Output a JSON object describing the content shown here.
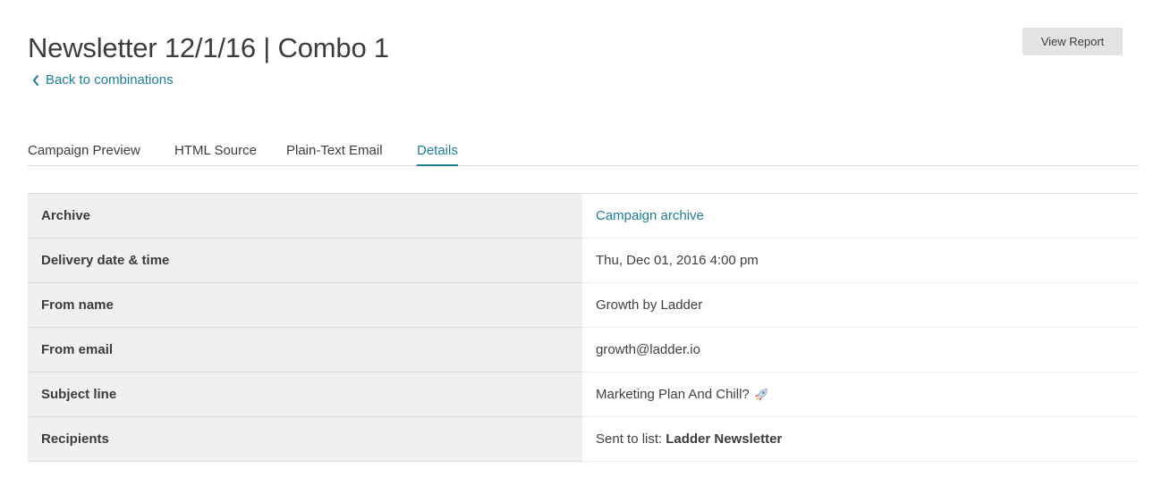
{
  "header": {
    "title": "Newsletter 12/1/16 | Combo 1",
    "back_label": "Back to combinations",
    "view_report_label": "View Report"
  },
  "tabs": [
    {
      "label": "Campaign Preview",
      "active": false
    },
    {
      "label": "HTML Source",
      "active": false
    },
    {
      "label": "Plain-Text Email",
      "active": false
    },
    {
      "label": "Details",
      "active": true
    }
  ],
  "details": {
    "archive": {
      "label": "Archive",
      "value": "Campaign archive"
    },
    "delivery": {
      "label": "Delivery date & time",
      "value": "Thu, Dec 01, 2016 4:00 pm"
    },
    "from_name": {
      "label": "From name",
      "value": "Growth by Ladder"
    },
    "from_email": {
      "label": "From email",
      "value": "growth@ladder.io"
    },
    "subject": {
      "label": "Subject line",
      "value": "Marketing Plan And Chill?",
      "icon": "rocket-icon"
    },
    "recipients": {
      "label": "Recipients",
      "prefix": "Sent to list:",
      "list_name": "Ladder Newsletter"
    }
  },
  "colors": {
    "accent": "#1f7c91",
    "label_bg": "#f0f0f0",
    "button_bg": "#e3e3e3"
  }
}
